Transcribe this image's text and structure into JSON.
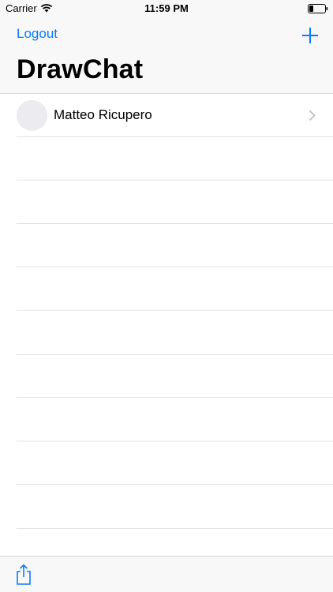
{
  "status_bar": {
    "carrier": "Carrier",
    "time": "11:59 PM"
  },
  "nav": {
    "left_button": "Logout",
    "title": "DrawChat"
  },
  "contacts": [
    {
      "name": "Matteo Ricupero"
    }
  ],
  "icons": {
    "wifi": "wifi-icon",
    "battery": "battery-icon",
    "add": "plus-icon",
    "chevron": "chevron-right-icon",
    "share": "share-icon"
  },
  "colors": {
    "accent": "#0a7aff",
    "bar_bg": "#f8f8f8",
    "separator": "#e3e3e6"
  }
}
